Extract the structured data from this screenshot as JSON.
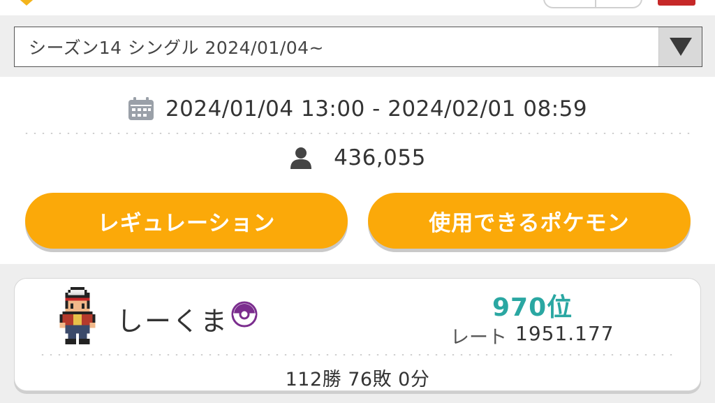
{
  "season": {
    "selected": "シーズン14 シングル 2024/01/04~"
  },
  "info": {
    "period": "2024/01/04 13:00 - 2024/02/01 08:59",
    "players": "436,055"
  },
  "buttons": {
    "regulation": "レギュレーション",
    "usable_pokemon": "使用できるポケモン"
  },
  "trainer": {
    "name": "しーくま",
    "rank": "970位",
    "rate_label": "レート",
    "rate_value": "1951.177",
    "record": "112勝 76敗 0分"
  },
  "colors": {
    "accent": "#fba909",
    "rank": "#2aa7a2",
    "ball_icon": "#7b2d8e"
  },
  "icons": [
    "calendar-icon",
    "person-icon",
    "dropdown-arrow-icon",
    "poke-ball-icon"
  ]
}
